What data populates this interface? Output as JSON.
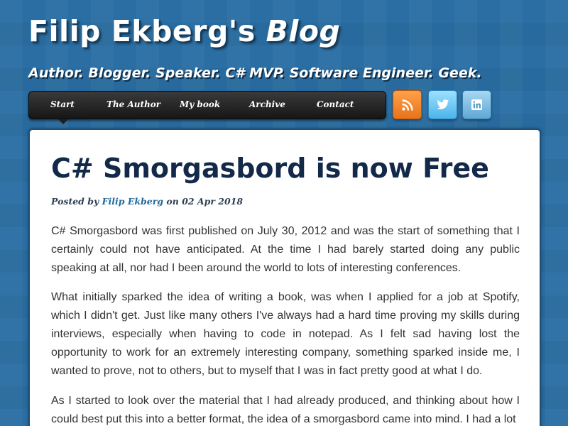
{
  "header": {
    "title_main": "Filip Ekberg's ",
    "title_accent": "Blog",
    "tagline": "Author. Blogger. Speaker. C# MVP. Software Engineer. Geek."
  },
  "nav": {
    "items": [
      {
        "label": "Start"
      },
      {
        "label": "The Author"
      },
      {
        "label": "My book"
      },
      {
        "label": "Archive"
      },
      {
        "label": "Contact"
      }
    ],
    "active": "Start"
  },
  "social": [
    {
      "name": "rss-icon",
      "color": "#f0842a"
    },
    {
      "name": "twitter-icon",
      "color": "#4bb4ea"
    },
    {
      "name": "linkedin-icon",
      "color": "#5fa8d6"
    }
  ],
  "post": {
    "title": "C# Smorgasbord is now Free",
    "meta_prefix": "Posted by ",
    "author": "Filip Ekberg",
    "meta_middle": " on ",
    "date": "02 Apr 2018",
    "paragraphs": [
      "C# Smorgasbord was first published on July 30, 2012 and was the start of something that I certainly could not have anticipated. At the time I had barely started doing any public speaking at all, nor had I been around the world to lots of interesting conferences.",
      "What initially sparked the idea of writing a book, was when I applied for a job at Spotify, which I didn't get. Just like many others I've always had a hard time proving my skills during interviews, especially when having to code in notepad. As I felt sad having lost the opportunity to work for an extremely interesting company, something sparked inside me, I wanted to prove, not to others, but to myself that I was in fact pretty good at what I do.",
      "As I started to look over the material that I had already produced, and thinking about how I could best put this into a better format, the idea of a smorgasbord came into mind. I had a lot"
    ]
  },
  "colors": {
    "background": "#2a6ea3",
    "title_text": "#13294a",
    "link": "#1f6a9a"
  }
}
